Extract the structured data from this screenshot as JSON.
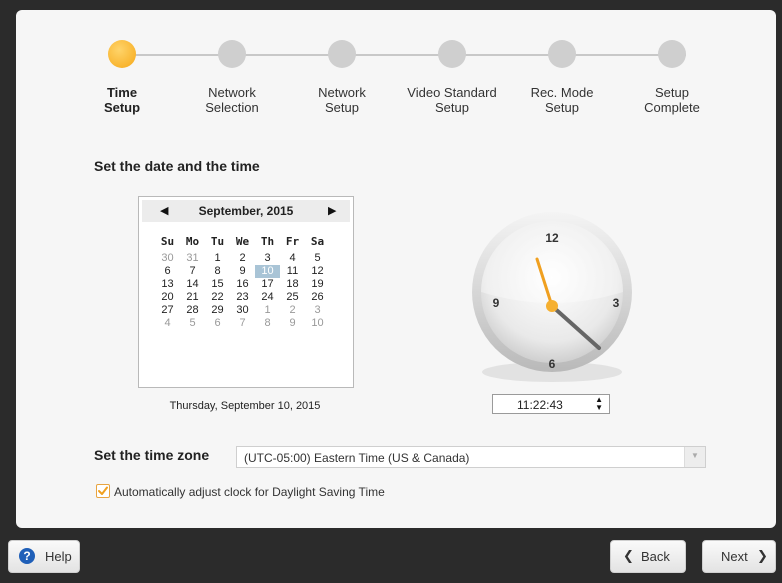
{
  "steps": [
    {
      "line1": "Time",
      "line2": "Setup",
      "active": true
    },
    {
      "line1": "Network",
      "line2": "Selection",
      "active": false
    },
    {
      "line1": "Network",
      "line2": "Setup",
      "active": false
    },
    {
      "line1": "Video Standard",
      "line2": "Setup",
      "active": false
    },
    {
      "line1": "Rec. Mode",
      "line2": "Setup",
      "active": false
    },
    {
      "line1": "Setup",
      "line2": "Complete",
      "active": false
    }
  ],
  "datetime": {
    "heading": "Set the date and the time",
    "calendar": {
      "month_title": "September, 2015",
      "prev_icon": "triangle-left-icon",
      "next_icon": "triangle-right-icon",
      "days_of_week": [
        "Su",
        "Mo",
        "Tu",
        "We",
        "Th",
        "Fr",
        "Sa"
      ],
      "weeks": [
        [
          "30",
          "31",
          "1",
          "2",
          "3",
          "4",
          "5"
        ],
        [
          "6",
          "7",
          "8",
          "9",
          "10",
          "11",
          "12"
        ],
        [
          "13",
          "14",
          "15",
          "16",
          "17",
          "18",
          "19"
        ],
        [
          "20",
          "21",
          "22",
          "23",
          "24",
          "25",
          "26"
        ],
        [
          "27",
          "28",
          "29",
          "30",
          "1",
          "2",
          "3"
        ],
        [
          "4",
          "5",
          "6",
          "7",
          "8",
          "9",
          "10"
        ]
      ],
      "selected_day": "10"
    },
    "selected_date_text": "Thursday, September 10, 2015",
    "clock_numbers": {
      "twelve": "12",
      "three": "3",
      "six": "6",
      "nine": "9"
    },
    "time_value": "11:22:43"
  },
  "timezone": {
    "heading": "Set the time zone",
    "value": "(UTC-05:00) Eastern Time (US & Canada)"
  },
  "dst": {
    "label": "Automatically adjust clock for Daylight Saving Time",
    "checked": true
  },
  "footer": {
    "help_label": "Help",
    "back_label": "Back",
    "next_label": "Next"
  },
  "colors": {
    "accent": "#f6a818",
    "selected_day": "#a9c4d6",
    "help_icon": "#1f5fb8"
  }
}
